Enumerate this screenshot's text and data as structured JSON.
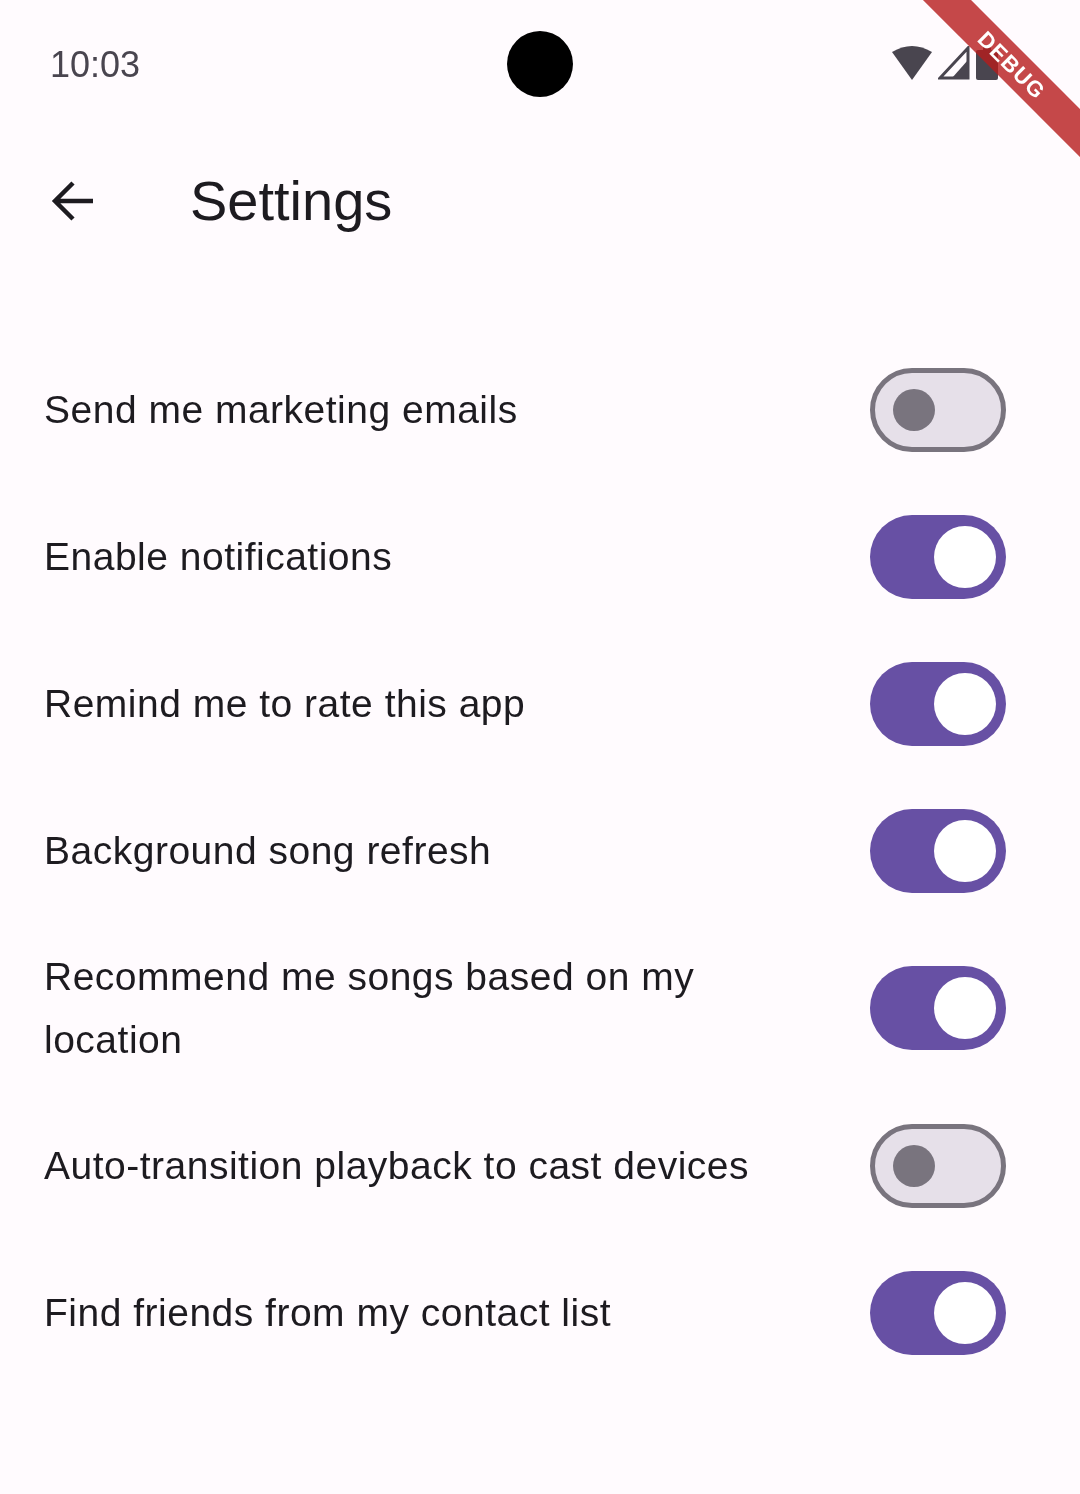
{
  "status_bar": {
    "time": "10:03"
  },
  "app_bar": {
    "title": "Settings"
  },
  "settings": [
    {
      "label": "Send me marketing emails",
      "on": false
    },
    {
      "label": "Enable notifications",
      "on": true
    },
    {
      "label": "Remind me to rate this app",
      "on": true
    },
    {
      "label": "Background song refresh",
      "on": true
    },
    {
      "label": "Recommend me songs based on my location",
      "on": true
    },
    {
      "label": "Auto-transition playback to cast devices",
      "on": false
    },
    {
      "label": "Find friends from my contact list",
      "on": true
    }
  ],
  "debug_banner": {
    "text": "DEBUG"
  }
}
